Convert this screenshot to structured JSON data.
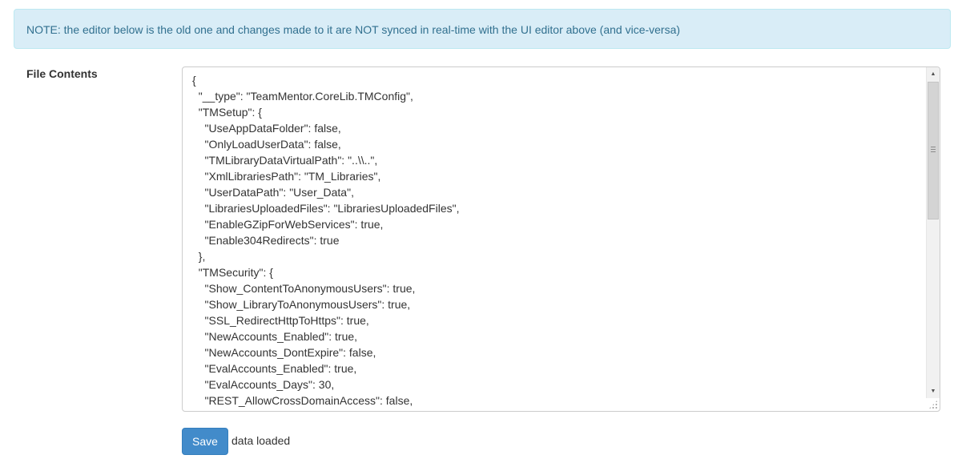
{
  "note": {
    "text": "NOTE: the editor below is the old one and changes made to it are NOT synced in real-time with the UI editor above (and vice-versa)"
  },
  "file_contents": {
    "label": "File Contents",
    "lines": [
      "{",
      "  \"__type\": \"TeamMentor.CoreLib.TMConfig\",",
      "  \"TMSetup\": {",
      "    \"UseAppDataFolder\": false,",
      "    \"OnlyLoadUserData\": false,",
      "    \"TMLibraryDataVirtualPath\": \"..\\\\..\",",
      "    \"XmlLibrariesPath\": \"TM_Libraries\",",
      "    \"UserDataPath\": \"User_Data\",",
      "    \"LibrariesUploadedFiles\": \"LibrariesUploadedFiles\",",
      "    \"EnableGZipForWebServices\": true,",
      "    \"Enable304Redirects\": true",
      "  },",
      "  \"TMSecurity\": {",
      "    \"Show_ContentToAnonymousUsers\": true,",
      "    \"Show_LibraryToAnonymousUsers\": true,",
      "    \"SSL_RedirectHttpToHttps\": true,",
      "    \"NewAccounts_Enabled\": true,",
      "    \"NewAccounts_DontExpire\": false,",
      "    \"EvalAccounts_Enabled\": true,",
      "    \"EvalAccounts_Days\": 30,",
      "    \"REST_AllowCrossDomainAccess\": false,"
    ]
  },
  "actions": {
    "save_label": "Save",
    "status_text": "data loaded"
  },
  "icons": {
    "scroll_up": "scroll-up-arrow-icon",
    "scroll_down": "scroll-down-arrow-icon"
  },
  "colors": {
    "note_background": "#d9edf7",
    "note_text": "#31708f",
    "save_button": "#428bca"
  }
}
